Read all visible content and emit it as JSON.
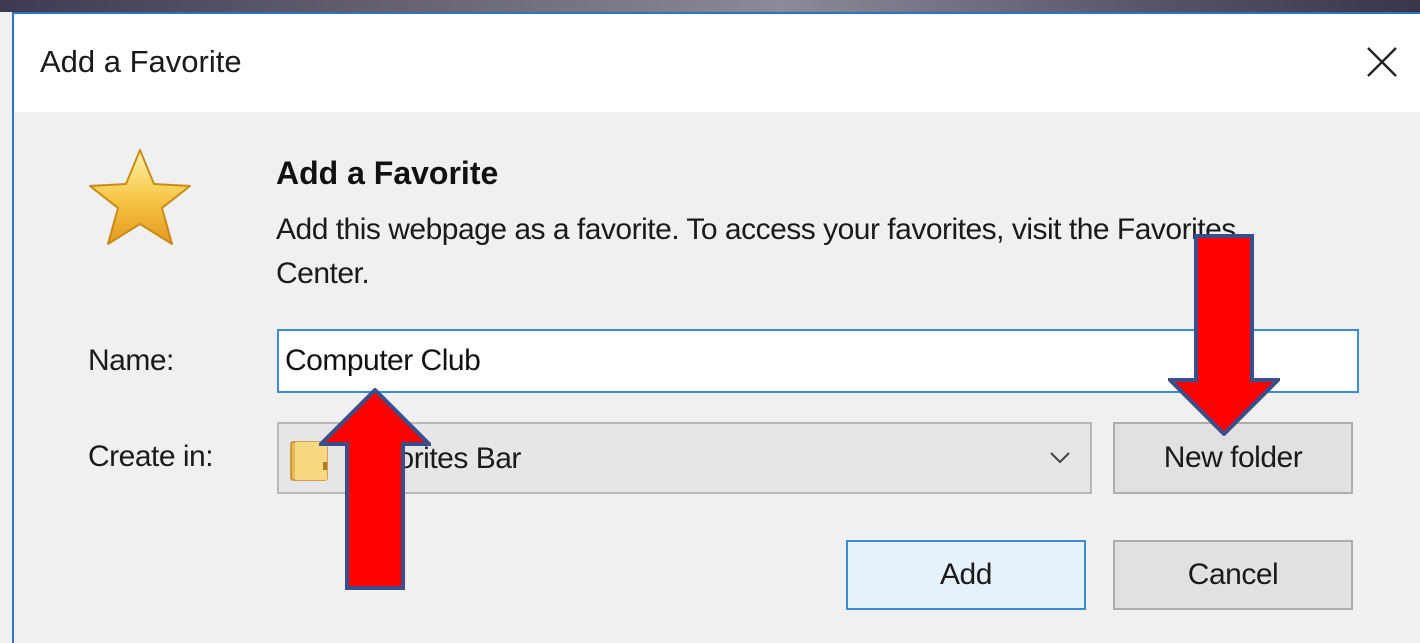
{
  "dialog": {
    "title": "Add a Favorite",
    "close_icon": "close-icon",
    "heading": "Add a Favorite",
    "description": "Add this webpage as a favorite. To access your favorites, visit the Favorites Center.",
    "star_icon": "star-icon"
  },
  "form": {
    "name_label": "Name:",
    "name_value": "Computer Club",
    "create_in_label": "Create in:",
    "create_in_value": "Favorites Bar",
    "folder_icon": "folder-icon",
    "dropdown_icon": "chevron-down-icon"
  },
  "buttons": {
    "new_folder": "New folder",
    "add": "Add",
    "cancel": "Cancel"
  },
  "annotations": {
    "arrow_color": "#ff0000",
    "arrow_outline": "#3a4f8a"
  },
  "colors": {
    "accent": "#2b74c7",
    "input_border": "#3c8bd9"
  }
}
